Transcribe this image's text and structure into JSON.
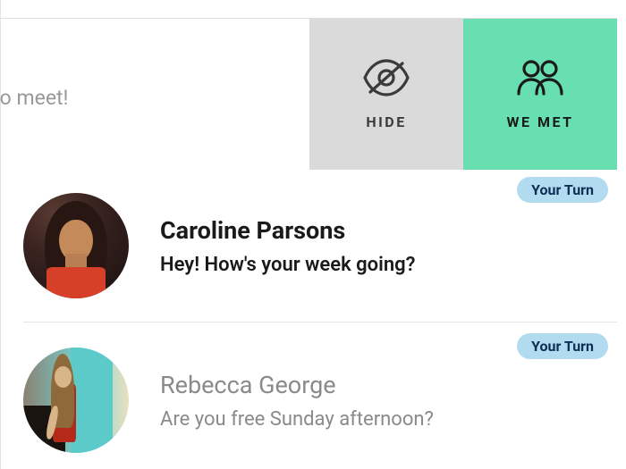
{
  "teaser": "ait to meet!",
  "actions": {
    "hide": "HIDE",
    "we_met": "WE MET"
  },
  "badge_label": "Your Turn",
  "conversations": [
    {
      "name": "Caroline Parsons",
      "message": "Hey! How's your week going?",
      "read": false
    },
    {
      "name": "Rebecca George",
      "message": "Are you free Sunday afternoon?",
      "read": true
    }
  ]
}
